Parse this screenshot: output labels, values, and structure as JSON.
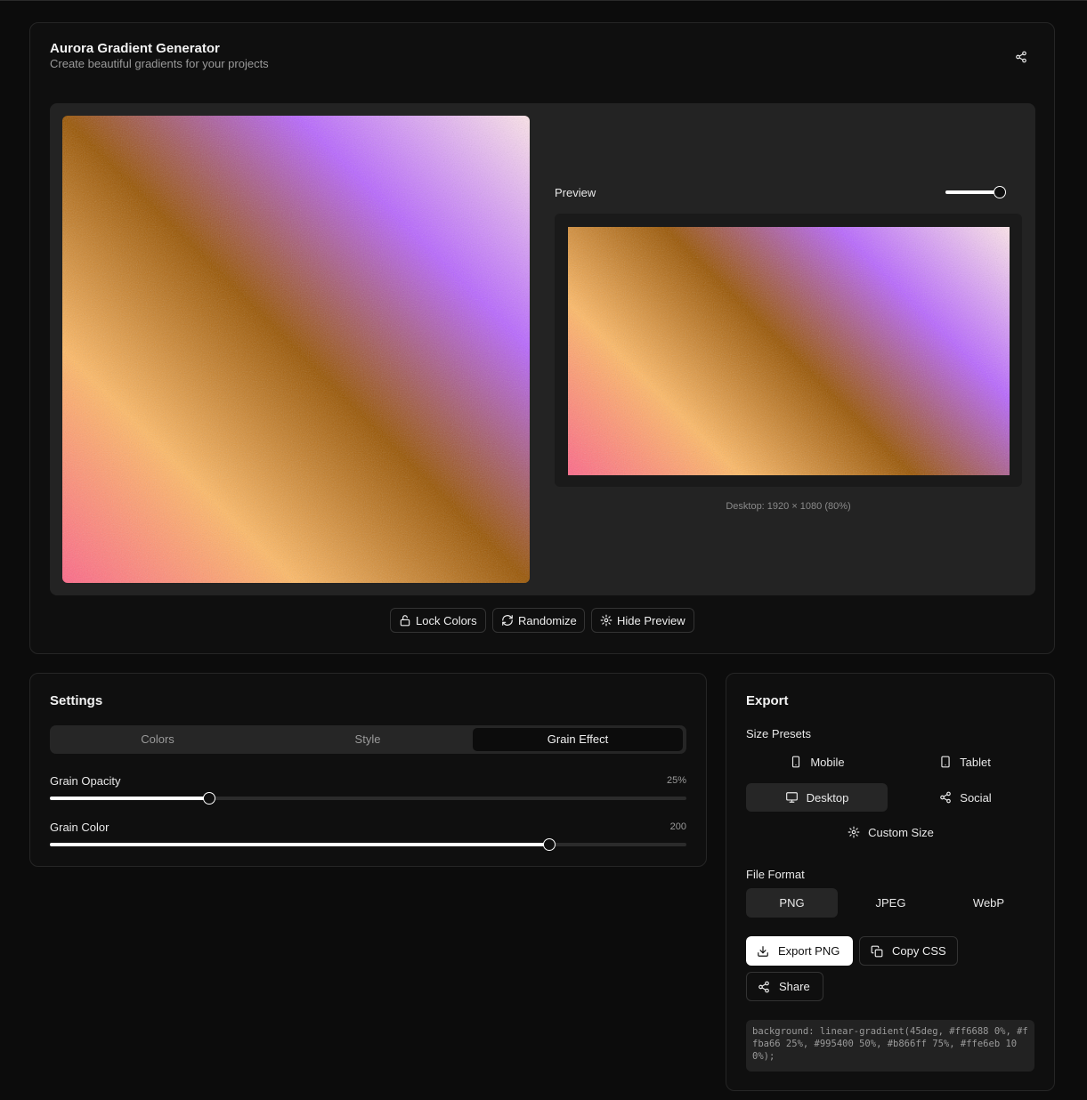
{
  "header": {
    "title": "Aurora Gradient Generator",
    "subtitle": "Create beautiful gradients for your projects",
    "share_icon": "share-icon"
  },
  "gradient": {
    "angle": "45deg",
    "stops": [
      {
        "color": "#ff6688",
        "position": "0%"
      },
      {
        "color": "#ffba66",
        "position": "25%"
      },
      {
        "color": "#995400",
        "position": "50%"
      },
      {
        "color": "#b866ff",
        "position": "75%"
      },
      {
        "color": "#ffe6eb",
        "position": "100%"
      }
    ]
  },
  "preview": {
    "label": "Preview",
    "zoom_level": 1.0,
    "caption": "Desktop: 1920 × 1080 (80%)"
  },
  "actions": {
    "lock": "Lock Colors",
    "randomize": "Randomize",
    "hide_preview": "Hide Preview"
  },
  "settings": {
    "title": "Settings",
    "tabs": [
      {
        "label": "Colors",
        "active": false
      },
      {
        "label": "Style",
        "active": false
      },
      {
        "label": "Grain Effect",
        "active": true
      }
    ],
    "sliders": [
      {
        "label": "Grain Opacity",
        "value_text": "25%",
        "value": 25,
        "min": 0,
        "max": 100
      },
      {
        "label": "Grain Color",
        "value_text": "200",
        "value": 200,
        "min": 0,
        "max": 255
      }
    ]
  },
  "export": {
    "title": "Export",
    "size_presets_label": "Size Presets",
    "presets": [
      {
        "label": "Mobile",
        "icon": "smartphone-icon",
        "active": false
      },
      {
        "label": "Tablet",
        "icon": "tablet-icon",
        "active": false
      },
      {
        "label": "Desktop",
        "icon": "monitor-icon",
        "active": true
      },
      {
        "label": "Social",
        "icon": "share-icon",
        "active": false
      },
      {
        "label": "Custom Size",
        "icon": "gear-icon",
        "active": false
      }
    ],
    "file_format_label": "File Format",
    "formats": [
      {
        "label": "PNG",
        "active": true
      },
      {
        "label": "JPEG",
        "active": false
      },
      {
        "label": "WebP",
        "active": false
      }
    ],
    "export_button": "Export PNG",
    "copy_css_button": "Copy CSS",
    "share_button": "Share",
    "css_code": "background: linear-gradient(45deg, #ff6688 0%, #ffba66 25%, #995400 50%, #b866ff 75%, #ffe6eb 100%);"
  },
  "colors": {
    "background": "#0c0c0c",
    "card": "#0f0f0f",
    "panel": "#232323",
    "accent": "#ffffff",
    "muted_text": "#9a9a9a"
  }
}
